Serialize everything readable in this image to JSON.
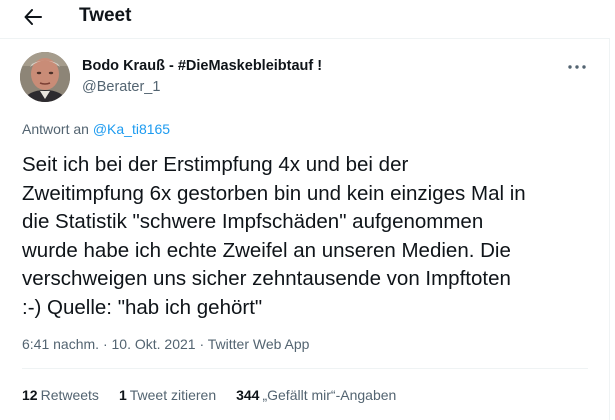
{
  "header": {
    "back_icon": "arrow-left-icon",
    "title": "Tweet"
  },
  "tweet": {
    "author": {
      "name": "Bodo Krauß - #DieMaskebleibtauf !",
      "handle": "@Berater_1",
      "avatar": "profile-photo"
    },
    "more_icon": "more-horizontal-icon",
    "reply": {
      "prefix": "Antwort an",
      "handle": "@Ka_ti8165"
    },
    "text": "Seit ich bei der Erstimpfung 4x und bei der\nZweitimpfung 6x gestorben bin und kein einziges Mal in\ndie Statistik \"schwere Impfschäden\" aufgenommen\nwurde habe ich echte Zweifel an unseren Medien. Die\nverschweigen uns sicher zehntausende von Impftoten\n:-) Quelle: \"hab ich gehört\"",
    "meta": {
      "time": "6:41 nachm.",
      "separator": "·",
      "date": "10. Okt. 2021",
      "source": "Twitter Web App"
    },
    "stats": {
      "retweets_count": "12",
      "retweets_label": "Retweets",
      "quotes_count": "1",
      "quotes_label": "Tweet zitieren",
      "likes_count": "344",
      "likes_label": "„Gefällt mir“-Angaben"
    }
  },
  "colors": {
    "text_primary": "#0f1419",
    "text_secondary": "#536471",
    "link": "#1d9bf0",
    "border": "#eff3f4"
  }
}
